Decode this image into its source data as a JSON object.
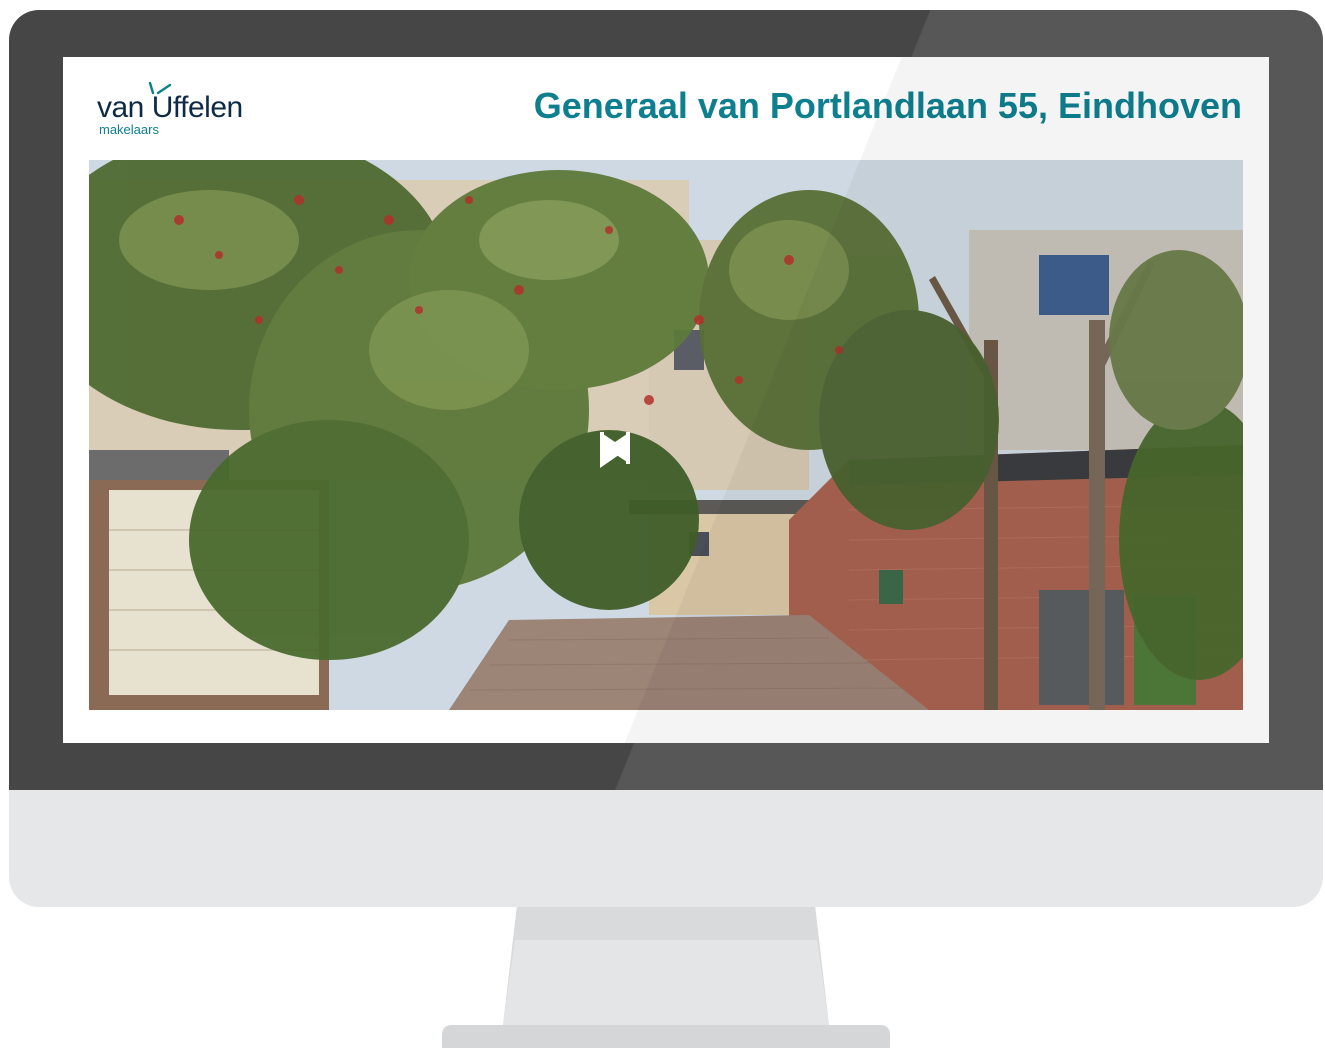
{
  "brand": {
    "logo_main": "van Uffelen",
    "logo_sub": "makelaars"
  },
  "listing": {
    "title": "Generaal van Portlandlaan 55, Eindhoven"
  },
  "player": {
    "prev_icon": "skip-previous-icon",
    "play_icon": "play-icon",
    "next_icon": "skip-next-icon"
  },
  "colors": {
    "accent": "#0e7f8f",
    "logo_navy": "#0f2a45",
    "bezel": "#464646",
    "chin": "#e6e7e9"
  }
}
